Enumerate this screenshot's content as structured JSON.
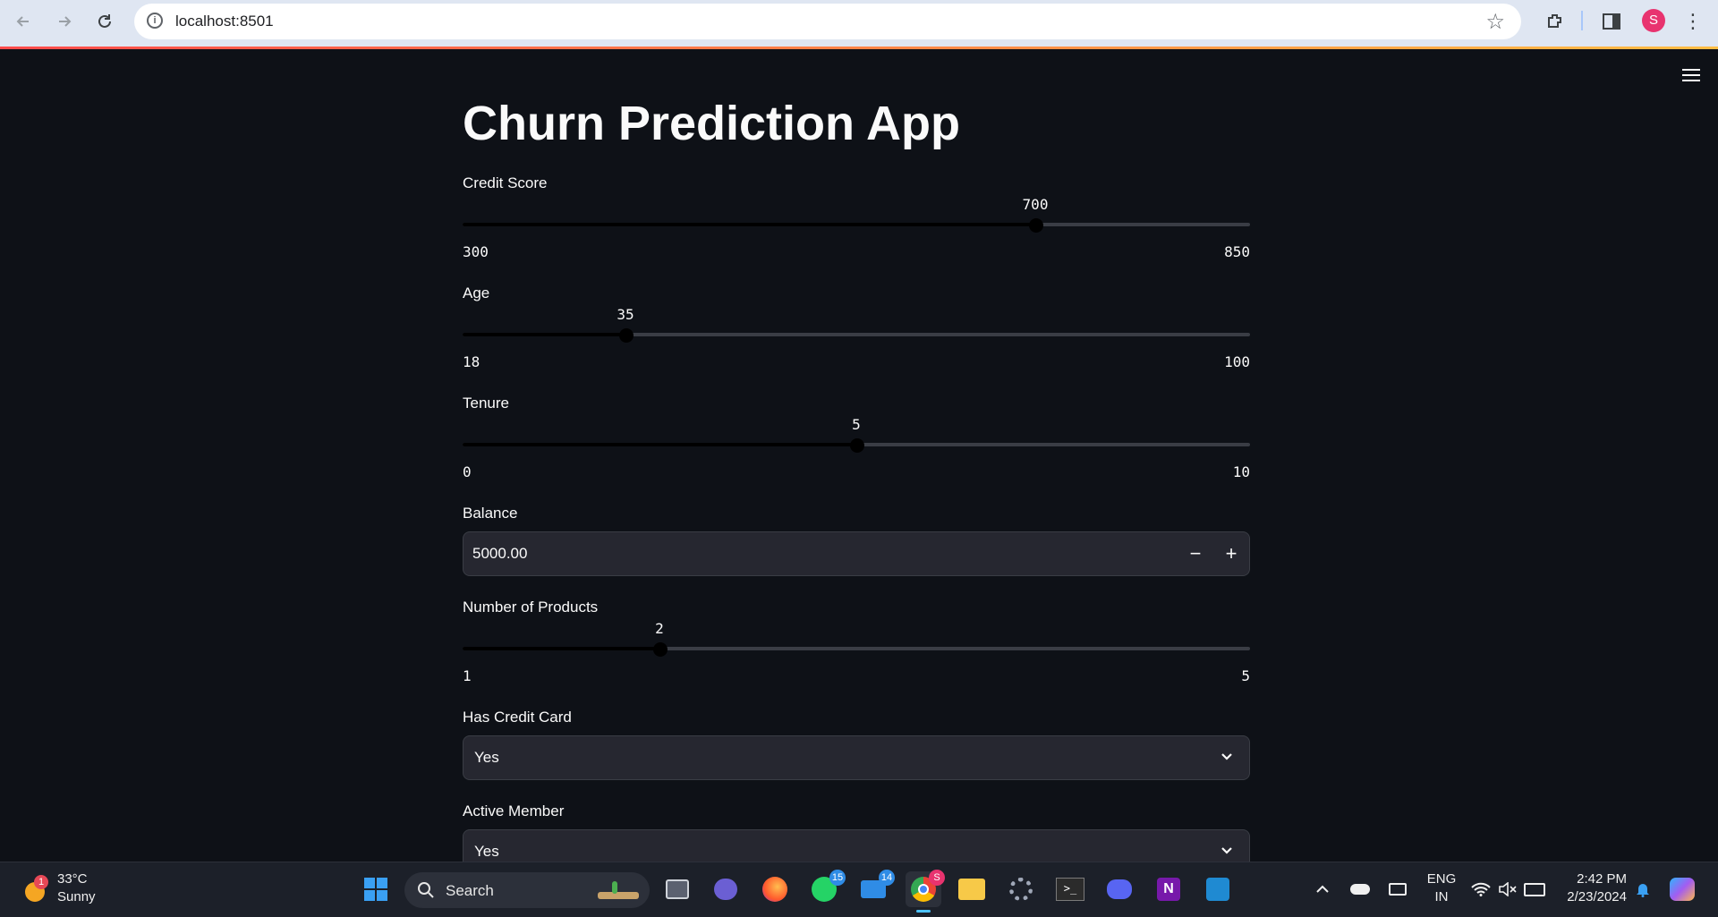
{
  "browser": {
    "url": "localhost:8501",
    "profile_initial": "S"
  },
  "app": {
    "title": "Churn Prediction App",
    "fields": {
      "credit_score": {
        "label": "Credit Score",
        "value": "700",
        "min": "300",
        "max": "850",
        "fraction": 0.7273
      },
      "age": {
        "label": "Age",
        "value": "35",
        "min": "18",
        "max": "100",
        "fraction": 0.2073
      },
      "tenure": {
        "label": "Tenure",
        "value": "5",
        "min": "0",
        "max": "10",
        "fraction": 0.5
      },
      "balance": {
        "label": "Balance",
        "value": "5000.00",
        "minus": "−",
        "plus": "+"
      },
      "num_products": {
        "label": "Number of Products",
        "value": "2",
        "min": "1",
        "max": "5",
        "fraction": 0.25
      },
      "has_credit_card": {
        "label": "Has Credit Card",
        "value": "Yes"
      },
      "active_member": {
        "label": "Active Member",
        "value": "Yes"
      }
    }
  },
  "taskbar": {
    "weather": {
      "temp": "33°C",
      "condition": "Sunny",
      "alert_count": "1"
    },
    "search_label": "Search",
    "badges": {
      "whatsapp": "15",
      "mail": "14",
      "chrome": "S"
    },
    "language": {
      "line1": "ENG",
      "line2": "IN"
    },
    "clock": {
      "time": "2:42 PM",
      "date": "2/23/2024"
    }
  },
  "colors": {
    "background": "#0e1117",
    "input_bg": "#262730",
    "accent_bar": "#ff4b4b"
  }
}
